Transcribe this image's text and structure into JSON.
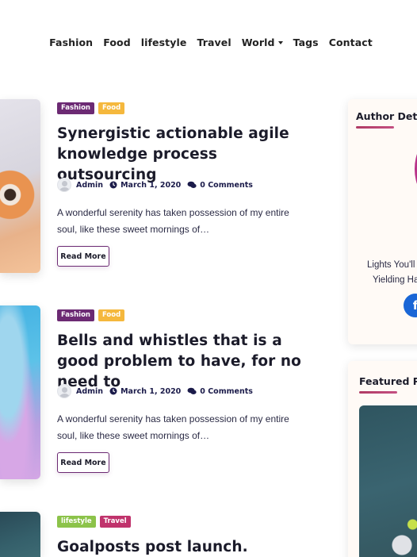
{
  "nav": {
    "items": [
      "Fashion",
      "Food",
      "lifestyle",
      "Travel",
      "World",
      "Tags",
      "Contact"
    ]
  },
  "colors": {
    "fashion": "#6c2a73",
    "food": "#f5b83d",
    "lifestyle": "#8cc34a",
    "travel": "#c0336c",
    "accent": "#6c2a73"
  },
  "posts": [
    {
      "categories": [
        "Fashion",
        "Food"
      ],
      "title": "Synergistic actionable agile knowledge process outsourcing",
      "author": "Admin",
      "date": "March 1, 2020",
      "comments": "0 Comments",
      "excerpt": "A wonderful serenity has taken possession of my entire soul, like these sweet mornings of…",
      "read_more": "Read More"
    },
    {
      "categories": [
        "Fashion",
        "Food"
      ],
      "title": "Bells and whistles that is a good problem to have, for no need to",
      "author": "Admin",
      "date": "March 1, 2020",
      "comments": "0 Comments",
      "excerpt": "A wonderful serenity has taken possession of my entire soul, like these sweet mornings of…",
      "read_more": "Read More"
    },
    {
      "categories": [
        "lifestyle",
        "Travel"
      ],
      "title": "Goalposts post launch. Regroup"
    }
  ],
  "sidebar": {
    "author_widget": {
      "title": "Author Deta",
      "line1": "Lights You'll",
      "line2": "Yielding Ha",
      "facebook_icon": "facebook-icon"
    },
    "featured_widget": {
      "title": "Featured P"
    }
  }
}
